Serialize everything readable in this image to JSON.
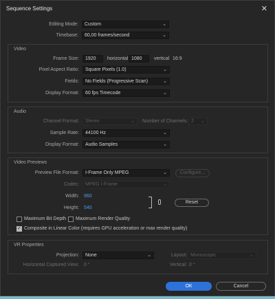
{
  "window": {
    "title": "Sequence Settings",
    "close_glyph": "✕"
  },
  "top": {
    "editing_mode_label": "Editing Mode:",
    "editing_mode_value": "Custom",
    "timebase_label": "Timebase:",
    "timebase_value": "60,00 frames/second"
  },
  "video": {
    "section": "Video",
    "frame_size_label": "Frame Size:",
    "frame_w": "1920",
    "horizontal": "horizontal",
    "frame_h": "1080",
    "vertical": "vertical",
    "aspect": "16:9",
    "par_label": "Pixel Aspect Ratio:",
    "par_value": "Square Pixels (1.0)",
    "fields_label": "Fields:",
    "fields_value": "No Fields (Progressive Scan)",
    "display_format_label": "Display Format:",
    "display_format_value": "60 fps Timecode"
  },
  "audio": {
    "section": "Audio",
    "channel_format_label": "Channel Format:",
    "channel_format_value": "Stereo",
    "num_channels_label": "Number of Channels:",
    "num_channels_value": "2",
    "sample_rate_label": "Sample Rate:",
    "sample_rate_value": "44100 Hz",
    "display_format_label": "Display Format:",
    "display_format_value": "Audio Samples"
  },
  "previews": {
    "section": "Video Previews",
    "preview_format_label": "Preview File Format:",
    "preview_format_value": "I-Frame Only MPEG",
    "configure_label": "Configure...",
    "codec_label": "Codec:",
    "codec_value": "MPEG I-Frame",
    "width_label": "Width:",
    "width_value": "960",
    "height_label": "Height:",
    "height_value": "540",
    "reset_label": "Reset",
    "max_bit_depth": "Maximum Bit Depth",
    "max_render_quality": "Maximum Render Quality",
    "linear_color": "Composite in Linear Color (requires GPU acceleration or max render quality)"
  },
  "vr": {
    "section": "VR Properties",
    "projection_label": "Projection:",
    "projection_value": "None",
    "layout_label": "Layout:",
    "layout_value": "Monoscopic",
    "h_view_label": "Horizontal Captured View:",
    "h_view_value": "0 °",
    "vertical_label": "Vertical:",
    "vertical_value": "0 °"
  },
  "footer": {
    "ok": "OK",
    "cancel": "Cancel"
  },
  "colors": {
    "accent": "#2d72d9",
    "link_value": "#4a9cf0",
    "background": "#262626"
  }
}
